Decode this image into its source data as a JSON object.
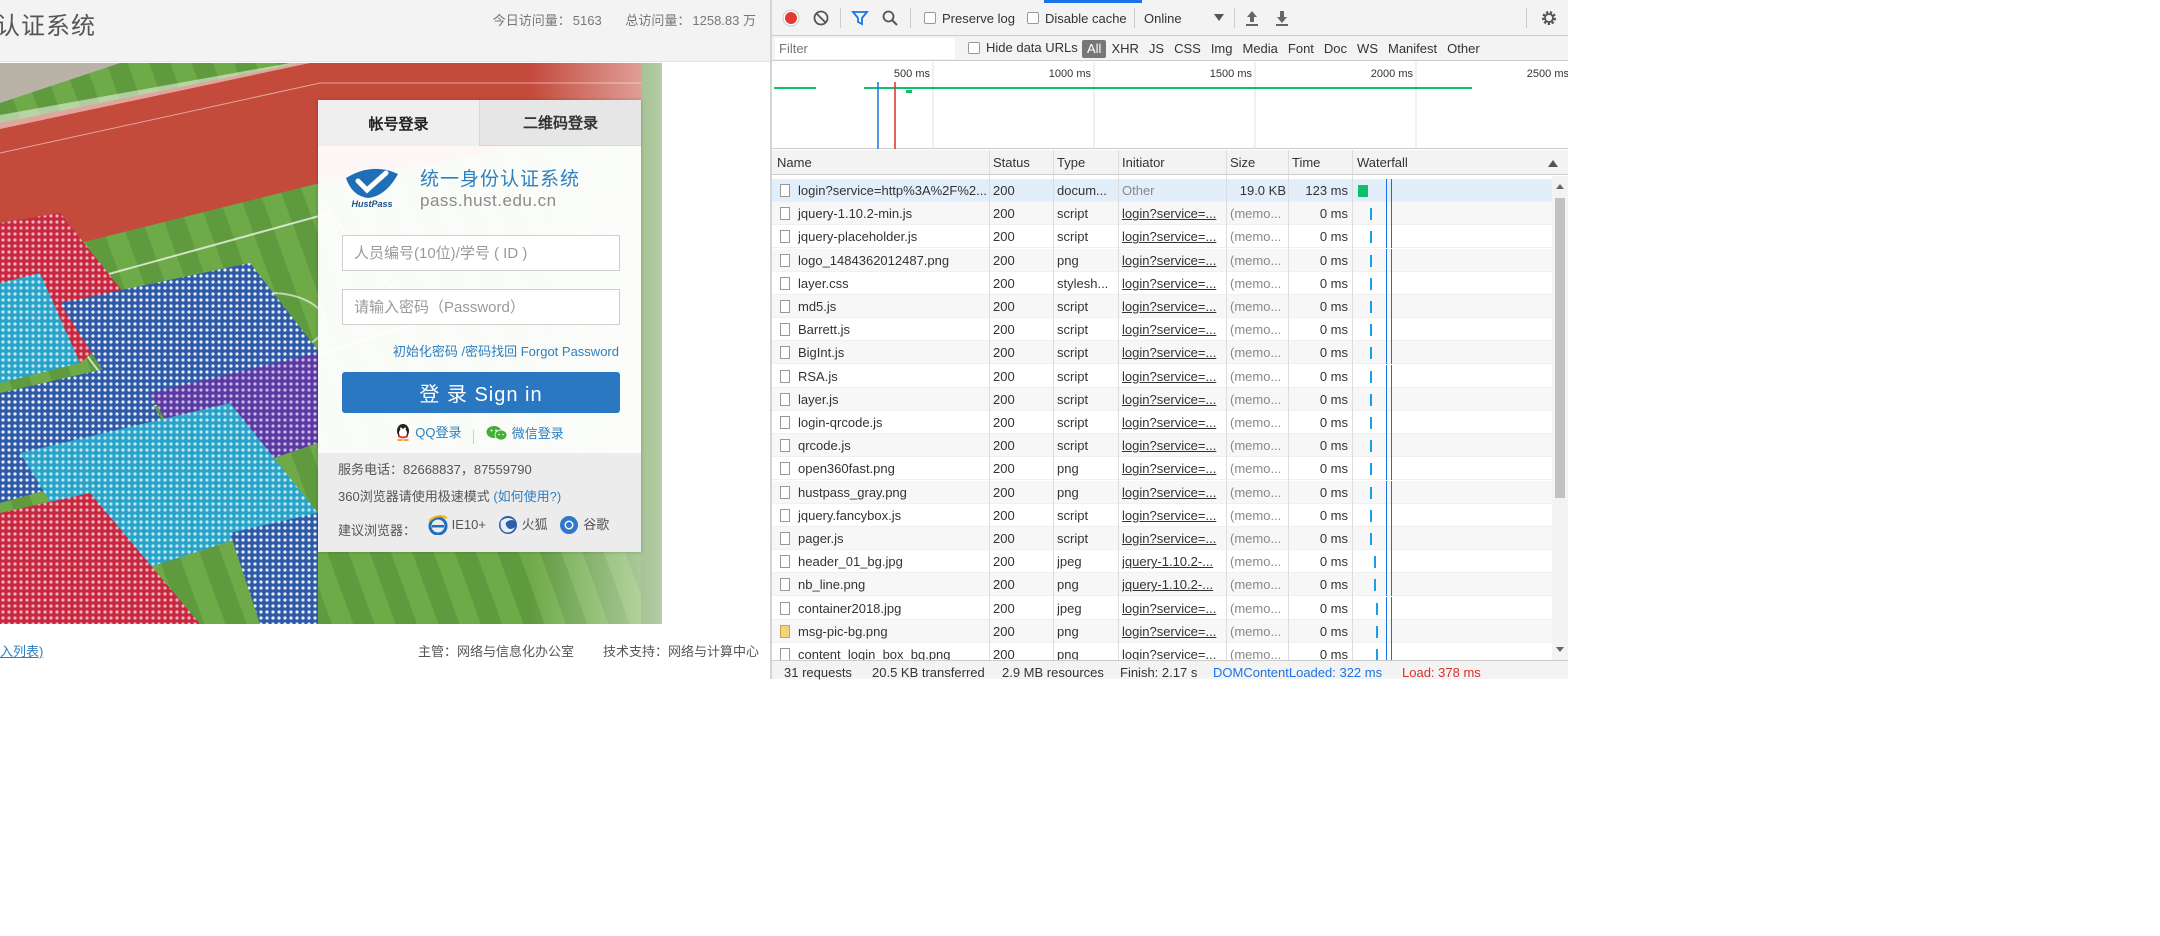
{
  "page": {
    "title": "认证系统",
    "visits_today_label": "今日访问量：",
    "visits_today": "5163",
    "visits_total_label": "总访问量：",
    "visits_total": "1258.83 万"
  },
  "login": {
    "tab_account": "帐号登录",
    "tab_qrcode": "二维码登录",
    "brand_cn": "统一身份认证系统",
    "brand_url": "pass.hust.edu.cn",
    "logo_text": "HustPass",
    "uid_placeholder": "人员编号(10位)/学号 ( ID )",
    "pwd_placeholder": "请输入密码（Password）",
    "forgot": "初始化密码 /密码找回 Forgot Password",
    "signin": "登  录  Sign in",
    "qq": "QQ登录",
    "wechat": "微信登录",
    "service_phone": "服务电话：82668837，87559790",
    "browser_note": "360浏览器请使用极速模式",
    "browser_help": "(如何使用?)",
    "recommend": "建议浏览器：",
    "ie": "IE10+",
    "firefox": "火狐",
    "chrome": "谷歌"
  },
  "footer": {
    "list_link": "入列表)",
    "manager": "主管：网络与信息化办公室",
    "tech": "技术支持：网络与计算中心"
  },
  "devtools": {
    "preserve_log": "Preserve log",
    "disable_cache": "Disable cache",
    "throttle": "Online",
    "filter_placeholder": "Filter",
    "hide_data_urls": "Hide data URLs",
    "types": [
      "All",
      "XHR",
      "JS",
      "CSS",
      "Img",
      "Media",
      "Font",
      "Doc",
      "WS",
      "Manifest",
      "Other"
    ],
    "ticks": [
      "500 ms",
      "1000 ms",
      "1500 ms",
      "2000 ms",
      "2500 ms"
    ],
    "columns": {
      "name": "Name",
      "status": "Status",
      "type": "Type",
      "initiator": "Initiator",
      "size": "Size",
      "time": "Time",
      "waterfall": "Waterfall"
    },
    "rows": [
      {
        "name": "login?service=http%3A%2F%2...",
        "status": "200",
        "type": "docum...",
        "initiator": "Other",
        "size": "19.0 KB",
        "time": "123 ms",
        "icon": "doc"
      },
      {
        "name": "jquery-1.10.2-min.js",
        "status": "200",
        "type": "script",
        "initiator": "login?service=...",
        "size": "(memo...",
        "time": "0 ms",
        "icon": "doc"
      },
      {
        "name": "jquery-placeholder.js",
        "status": "200",
        "type": "script",
        "initiator": "login?service=...",
        "size": "(memo...",
        "time": "0 ms",
        "icon": "doc"
      },
      {
        "name": "logo_1484362012487.png",
        "status": "200",
        "type": "png",
        "initiator": "login?service=...",
        "size": "(memo...",
        "time": "0 ms",
        "icon": "img-dash"
      },
      {
        "name": "layer.css",
        "status": "200",
        "type": "stylesh...",
        "initiator": "login?service=...",
        "size": "(memo...",
        "time": "0 ms",
        "icon": "doc"
      },
      {
        "name": "md5.js",
        "status": "200",
        "type": "script",
        "initiator": "login?service=...",
        "size": "(memo...",
        "time": "0 ms",
        "icon": "doc"
      },
      {
        "name": "Barrett.js",
        "status": "200",
        "type": "script",
        "initiator": "login?service=...",
        "size": "(memo...",
        "time": "0 ms",
        "icon": "doc"
      },
      {
        "name": "BigInt.js",
        "status": "200",
        "type": "script",
        "initiator": "login?service=...",
        "size": "(memo...",
        "time": "0 ms",
        "icon": "doc"
      },
      {
        "name": "RSA.js",
        "status": "200",
        "type": "script",
        "initiator": "login?service=...",
        "size": "(memo...",
        "time": "0 ms",
        "icon": "doc"
      },
      {
        "name": "layer.js",
        "status": "200",
        "type": "script",
        "initiator": "login?service=...",
        "size": "(memo...",
        "time": "0 ms",
        "icon": "doc"
      },
      {
        "name": "login-qrcode.js",
        "status": "200",
        "type": "script",
        "initiator": "login?service=...",
        "size": "(memo...",
        "time": "0 ms",
        "icon": "doc"
      },
      {
        "name": "qrcode.js",
        "status": "200",
        "type": "script",
        "initiator": "login?service=...",
        "size": "(memo...",
        "time": "0 ms",
        "icon": "doc"
      },
      {
        "name": "open360fast.png",
        "status": "200",
        "type": "png",
        "initiator": "login?service=...",
        "size": "(memo...",
        "time": "0 ms",
        "icon": "doc"
      },
      {
        "name": "hustpass_gray.png",
        "status": "200",
        "type": "png",
        "initiator": "login?service=...",
        "size": "(memo...",
        "time": "0 ms",
        "icon": "img-dash"
      },
      {
        "name": "jquery.fancybox.js",
        "status": "200",
        "type": "script",
        "initiator": "login?service=...",
        "size": "(memo...",
        "time": "0 ms",
        "icon": "doc"
      },
      {
        "name": "pager.js",
        "status": "200",
        "type": "script",
        "initiator": "login?service=...",
        "size": "(memo...",
        "time": "0 ms",
        "icon": "doc"
      },
      {
        "name": "header_01_bg.jpg",
        "status": "200",
        "type": "jpeg",
        "initiator": "jquery-1.10.2-...",
        "size": "(memo...",
        "time": "0 ms",
        "icon": "doc"
      },
      {
        "name": "nb_line.png",
        "status": "200",
        "type": "png",
        "initiator": "jquery-1.10.2-...",
        "size": "(memo...",
        "time": "0 ms",
        "icon": "doc"
      },
      {
        "name": "container2018.jpg",
        "status": "200",
        "type": "jpeg",
        "initiator": "login?service=...",
        "size": "(memo...",
        "time": "0 ms",
        "icon": "img-dash"
      },
      {
        "name": "msg-pic-bg.png",
        "status": "200",
        "type": "png",
        "initiator": "login?service=...",
        "size": "(memo...",
        "time": "0 ms",
        "icon": "img"
      },
      {
        "name": "content_login_box_bg.png",
        "status": "200",
        "type": "png",
        "initiator": "login?service=...",
        "size": "(memo...",
        "time": "0 ms",
        "icon": "doc"
      }
    ],
    "status": {
      "requests": "31 requests",
      "transferred": "20.5 KB transferred",
      "resources": "2.9 MB resources",
      "finish": "Finish: 2.17 s",
      "dcl": "DOMContentLoaded: 322 ms",
      "load": "Load: 378 ms"
    },
    "colors": {
      "record": "#e53935",
      "dcl": "#1a73e8",
      "load": "#d93025",
      "bar": "#1a9ee8",
      "doc_bar": "#0fbf6b"
    }
  }
}
